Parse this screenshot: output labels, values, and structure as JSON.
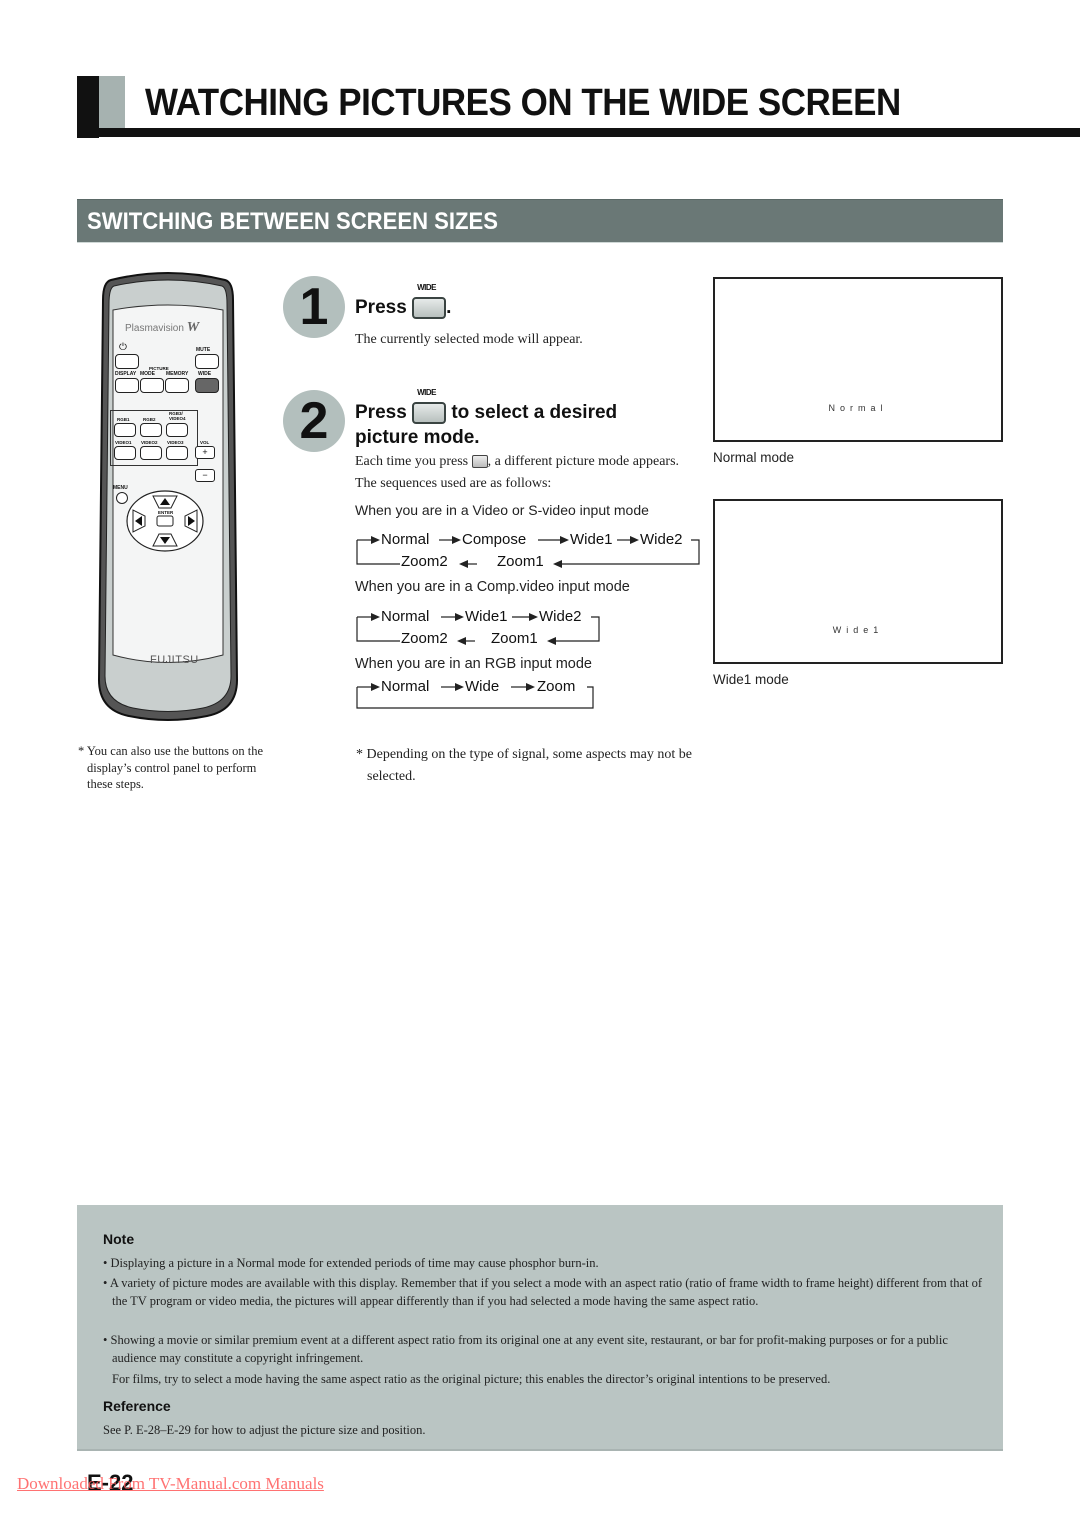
{
  "page": {
    "title": "WATCHING PICTURES ON THE WIDE SCREEN",
    "section_title": "SWITCHING BETWEEN SCREEN SIZES",
    "page_number": "E-22",
    "watermark": "Downloaded From TV-Manual.com Manuals"
  },
  "remote": {
    "brand_top": "Plasmavision",
    "brand_top_mark": "W",
    "brand_bottom": "FUJITSU",
    "buttons": {
      "power": "⏻",
      "mute": "MUTE",
      "display": "DISPLAY",
      "picture_group": "PICTURE",
      "mode": "MODE",
      "memory": "MEMORY",
      "wide": "WIDE",
      "rgb1": "RGB1",
      "rgb2": "RGB2",
      "rgb3_video4": "RGB3/ VIDEO4",
      "video1": "VIDEO1",
      "video2": "VIDEO2",
      "video3": "VIDEO3",
      "vol": "VOL",
      "vol_plus": "+",
      "vol_minus": "−",
      "menu": "MENU",
      "enter": "ENTER"
    },
    "footnote": "* You can also use the buttons on the display’s control panel to perform these steps."
  },
  "steps": [
    {
      "number": "1",
      "heading_pre": "Press",
      "heading_post": ".",
      "button_label": "WIDE",
      "body": "The currently selected mode will appear."
    },
    {
      "number": "2",
      "heading_pre": "Press",
      "heading_post": "to select a desired",
      "heading_line2": "picture mode.",
      "button_label": "WIDE",
      "body_pre": "Each time you press",
      "body_post": ", a different picture mode appears.  The sequences used are as follows:"
    }
  ],
  "sequences": [
    {
      "label": "When you are in a Video or S-video input mode",
      "row1": [
        "Normal",
        "Compose",
        "Wide1",
        "Wide2"
      ],
      "row2": [
        "Zoom2",
        "Zoom1"
      ]
    },
    {
      "label": "When you are in a Comp.video input mode",
      "row1": [
        "Normal",
        "Wide1",
        "Wide2"
      ],
      "row2": [
        "Zoom2",
        "Zoom1"
      ]
    },
    {
      "label": "When you are in an RGB input mode",
      "row1": [
        "Normal",
        "Wide",
        "Zoom"
      ],
      "row2": []
    }
  ],
  "sequence_footnote": "* Depending on the type of signal, some aspects may not be selected.",
  "previews": [
    {
      "screen_text": "Normal",
      "caption": "Normal mode"
    },
    {
      "screen_text": "Wide1",
      "caption": "Wide1 mode"
    }
  ],
  "note": {
    "heading": "Note",
    "bullets": [
      "Displaying a picture in a Normal mode for extended periods of time may cause phosphor burn-in.",
      "A variety of picture modes are available with this display.  Remember that if you select a mode with an aspect ratio (ratio of frame width to frame height) different from that of the TV program or video media, the pictures will appear differently than if you had selected a mode having the same aspect ratio.",
      "Showing a movie or similar premium event at a different aspect ratio from its original one at any event site, restaurant, or bar for profit-making purposes or for a public audience may constitute a copyright infringement."
    ],
    "extra": "For films, try to select a mode having the same aspect ratio as the original picture; this enables the director’s original intentions to be preserved.",
    "reference_heading": "Reference",
    "reference_text": "See P. E-28–E-29 for how to adjust the picture size and position."
  },
  "colors": {
    "section_bg": "#6a7876",
    "step_circle": "#b3bfbd",
    "note_bg": "#bac5c3",
    "watermark": "#ff5a5a"
  }
}
